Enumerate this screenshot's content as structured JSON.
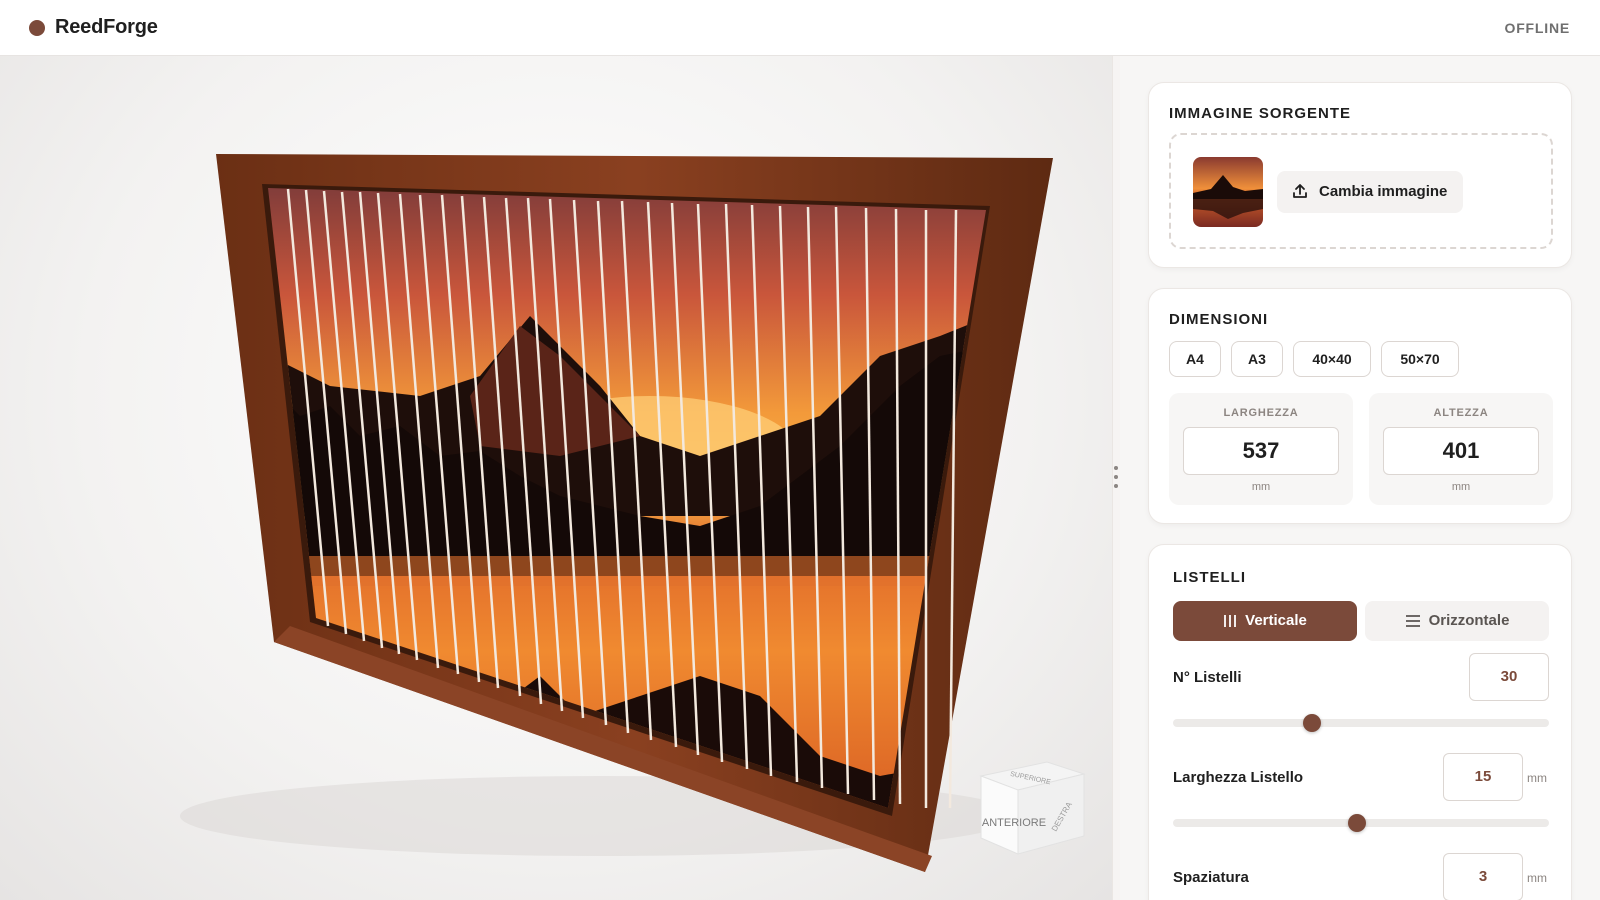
{
  "app": {
    "name": "ReedForge",
    "status": "OFFLINE",
    "brand_color": "#7b4a3a"
  },
  "viewport": {
    "view_cube": {
      "top": "SUPERIORE",
      "front": "ANTERIORE",
      "right": "DESTRA"
    }
  },
  "source_image": {
    "title": "IMMAGINE SORGENTE",
    "change_button": "Cambia immagine",
    "upload_icon": "upload-icon"
  },
  "dimensions": {
    "title": "DIMENSIONI",
    "presets": [
      "A4",
      "A3",
      "40×40",
      "50×70"
    ],
    "width": {
      "label": "LARGHEZZA",
      "value": "537",
      "unit": "mm"
    },
    "height": {
      "label": "ALTEZZA",
      "value": "401",
      "unit": "mm"
    }
  },
  "slats": {
    "title": "LISTELLI",
    "orientation": {
      "vertical": "Verticale",
      "horizontal": "Orizzontale",
      "selected": "vertical"
    },
    "count": {
      "label": "N° Listelli",
      "value": "30",
      "slider_fraction": 0.37
    },
    "width": {
      "label": "Larghezza Listello",
      "value": "15",
      "unit": "mm",
      "slider_fraction": 0.49
    },
    "spacing": {
      "label": "Spaziatura",
      "value": "3",
      "unit": "mm"
    }
  }
}
